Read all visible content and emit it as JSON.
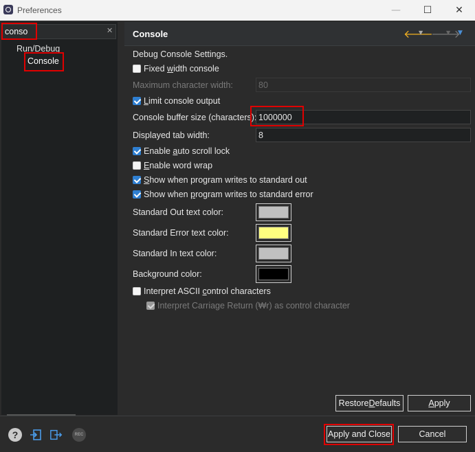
{
  "window": {
    "title": "Preferences"
  },
  "titlebar_buttons": {
    "minimize": "—",
    "maximize": "☐",
    "close": "✕"
  },
  "filter": {
    "value": "conso"
  },
  "tree": {
    "parent": "Run/Debug",
    "child": "Console"
  },
  "page": {
    "title": "Console",
    "section_label": "Debug Console Settings."
  },
  "settings": {
    "fixed_width": {
      "pre": "Fixed ",
      "u": "w",
      "post": "idth console",
      "checked": false
    },
    "max_char_width": {
      "label": "Maximum character width:",
      "value": "80"
    },
    "limit_output": {
      "pre": "",
      "u": "L",
      "post": "imit console output",
      "checked": true
    },
    "buffer_size": {
      "label": "Console buffer size (characters):",
      "value": "1000000"
    },
    "tab_width": {
      "label": "Displayed tab width:",
      "value": "8"
    },
    "auto_scroll": {
      "pre": "Enable ",
      "u": "a",
      "post": "uto scroll lock",
      "checked": true
    },
    "word_wrap": {
      "pre": "",
      "u": "E",
      "post": "nable word wrap",
      "checked": false
    },
    "show_stdout": {
      "pre": "",
      "u": "S",
      "post": "how when program writes to standard out",
      "checked": true
    },
    "show_stderr": {
      "pre": "Show when ",
      "u": "p",
      "post": "rogram writes to standard error",
      "checked": true
    },
    "stdout_color": {
      "label": "Standard Out text color:",
      "color": "#c0c0c0"
    },
    "stderr_color": {
      "label": "Standard Error text color:",
      "color": "#ffff80"
    },
    "stdin_color": {
      "label": "Standard In text color:",
      "color": "#c0c0c0"
    },
    "bg_color": {
      "label": "Background color:",
      "color": "#000000"
    },
    "ascii_control": {
      "pre": "Interpret ASCII ",
      "u": "c",
      "post": "ontrol characters",
      "checked": false
    },
    "carriage_return": {
      "label": "Interpret Carriage Return (₩r) as control character",
      "checked": true,
      "enabled": false
    }
  },
  "buttons": {
    "restore": {
      "pre": "Restore ",
      "u": "D",
      "post": "efaults"
    },
    "apply": {
      "pre": "",
      "u": "A",
      "post": "pply"
    },
    "apply_close": "Apply and Close",
    "cancel": "Cancel"
  },
  "icons": {
    "help": "?",
    "rec": "REC",
    "nav_back": "🡐",
    "nav_forward": "🡒",
    "dropdown": "▼"
  },
  "colors": {
    "accent": "#2f7fd1",
    "highlight": "#e00000",
    "nav_back": "#f2b020"
  }
}
